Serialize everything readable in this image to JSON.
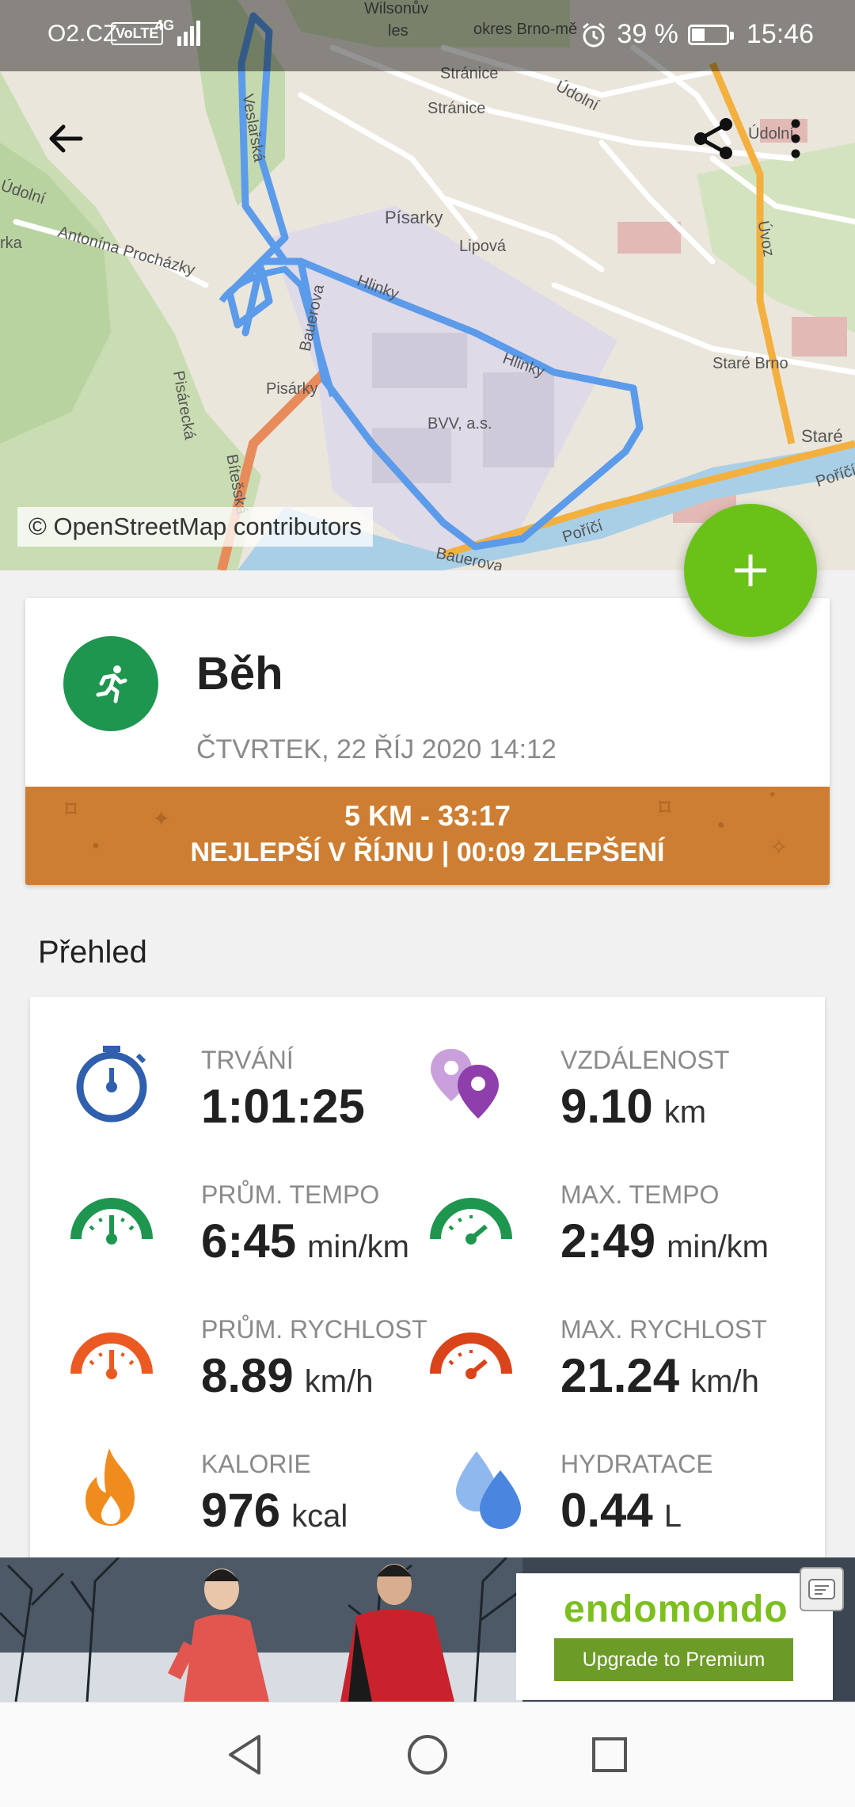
{
  "status_bar": {
    "carrier": "O2.CZ",
    "volte": "VoLTE",
    "network": "4G",
    "battery_percent": "39 %",
    "battery_level": 0.39,
    "time": "15:46"
  },
  "map": {
    "labels": {
      "wilsonuv": "Wilsonův",
      "les": "les",
      "okres": "okres Brno-mě",
      "stranice1": "Stránice",
      "stranice2": "Stránice",
      "udolni1": "Údolní",
      "udolni2": "Údolní",
      "udolni3": "Údolní",
      "pisarky": "Písarky",
      "lipova": "Lipová",
      "antonina": "Antonína Procházky",
      "hlinky1": "Hlinky",
      "hlinky2": "Hlinky",
      "uvoz": "Úvoz",
      "stare_brno": "Staré Brno",
      "stare": "Staré",
      "porici1": "Poříčí",
      "porici2": "Poříčí",
      "bvas": "BVV, a.s.",
      "pisarky2": "Pisárky",
      "pisarecka": "Pisárecká",
      "bitesska": "Bítešská",
      "bauerova1": "Bauerova",
      "bauerova2": "Bauerova",
      "veslarska": "Veslařská",
      "ark": "rka"
    },
    "credit": "© OpenStreetMap contributors",
    "route_color": "#5b9bea"
  },
  "toolbar": {
    "back_icon": "arrow-left-icon",
    "share_icon": "share-icon",
    "more_icon": "more-vert-icon"
  },
  "fab": {
    "icon": "plus-icon",
    "color": "#6ac218"
  },
  "workout": {
    "sport": "Běh",
    "date": "ČTVRTEK, 22 ŘÍJ 2020 14:12",
    "record_line1": "5 KM  -  33:17",
    "record_line2": "NEJLEPŠÍ V ŘÍJNU  |  00:09 ZLEPŠENÍ"
  },
  "overview": {
    "title": "Přehled",
    "stats": [
      {
        "label": "TRVÁNÍ",
        "value": "1:01:25",
        "unit": "",
        "icon": "stopwatch-icon"
      },
      {
        "label": "VZDÁLENOST",
        "value": "9.10",
        "unit": "km",
        "icon": "location-pins-icon"
      },
      {
        "label": "PRŮM. TEMPO",
        "value": "6:45",
        "unit": "min/km",
        "icon": "gauge-green-icon"
      },
      {
        "label": "MAX. TEMPO",
        "value": "2:49",
        "unit": "min/km",
        "icon": "gauge-green-max-icon"
      },
      {
        "label": "PRŮM. RYCHLOST",
        "value": "8.89",
        "unit": "km/h",
        "icon": "gauge-orange-icon"
      },
      {
        "label": "MAX. RYCHLOST",
        "value": "21.24",
        "unit": "km/h",
        "icon": "gauge-orange-max-icon"
      },
      {
        "label": "KALORIE",
        "value": "976",
        "unit": "kcal",
        "icon": "flame-icon"
      },
      {
        "label": "HYDRATACE",
        "value": "0.44",
        "unit": "L",
        "icon": "water-drops-icon"
      }
    ]
  },
  "ad": {
    "logo": "endomondo",
    "button": "Upgrade to Premium"
  },
  "nav": {
    "back": "nav-back-icon",
    "home": "nav-home-icon",
    "recents": "nav-recents-icon"
  }
}
